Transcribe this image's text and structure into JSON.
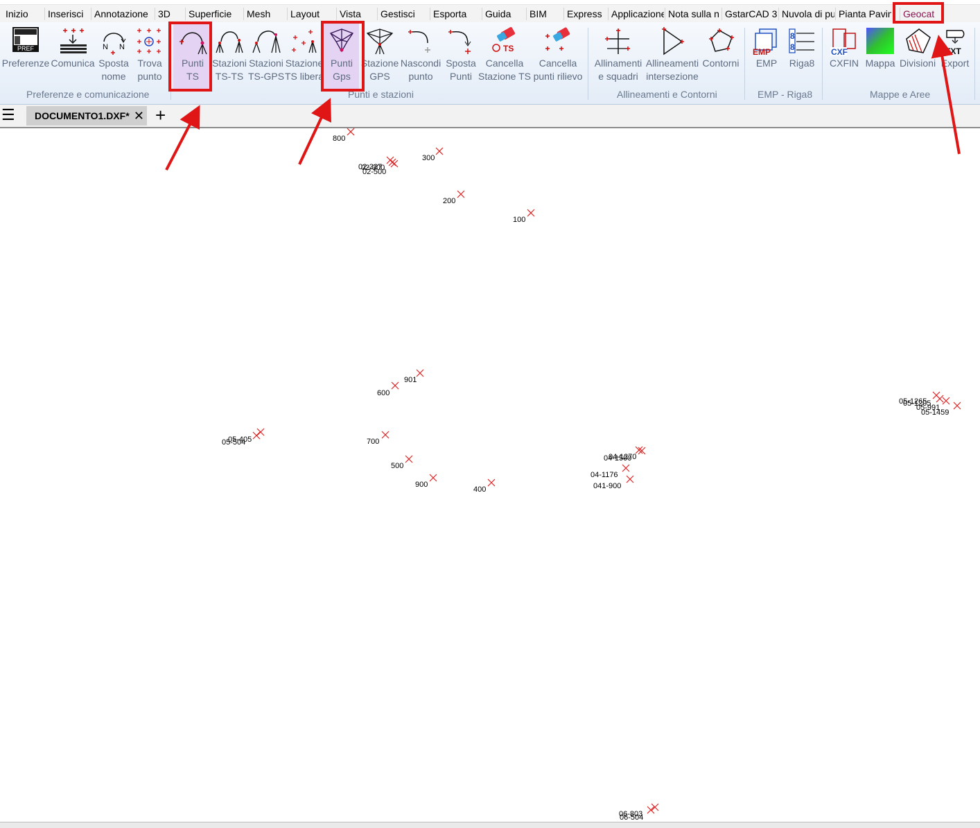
{
  "menu": {
    "items": [
      "Inizio",
      "Inserisci",
      "Annotazione",
      "3D",
      "Superficie",
      "Mesh",
      "Layout",
      "Vista",
      "Gestisci",
      "Esporta",
      "Guida",
      "BIM",
      "Express",
      "Applicazione",
      "Nota sulla n",
      "GstarCAD 3",
      "Nuvola di pu",
      "Pianta Pavin",
      "Geocat"
    ],
    "active": "Geocat"
  },
  "ribbon": {
    "buttons": [
      {
        "label": "Preferenze",
        "icon": "pref-icon"
      },
      {
        "label": "Comunica",
        "icon": "comunica-icon"
      },
      {
        "label": "Sposta\nnome",
        "icon": "sposta-nome-icon"
      },
      {
        "label": "Trova\npunto",
        "icon": "trova-punto-icon"
      },
      {
        "label": "Punti\nTS",
        "icon": "punti-ts-icon"
      },
      {
        "label": "Stazioni\nTS-TS",
        "icon": "stazioni-ts-ts-icon"
      },
      {
        "label": "Stazioni\nTS-GPS",
        "icon": "stazioni-ts-gps-icon"
      },
      {
        "label": "Stazione\nTS libera",
        "icon": "stazione-ts-libera-icon"
      },
      {
        "label": "Punti\nGps",
        "icon": "punti-gps-icon"
      },
      {
        "label": "Stazione\nGPS",
        "icon": "stazione-gps-icon"
      },
      {
        "label": "Nascondi\npunto",
        "icon": "nascondi-punto-icon"
      },
      {
        "label": "Sposta\nPunti",
        "icon": "sposta-punti-icon"
      },
      {
        "label": "Cancella\nStazione TS",
        "icon": "cancella-stazione-ts-icon"
      },
      {
        "label": "Cancella\npunti rilievo",
        "icon": "cancella-punti-rilievo-icon"
      },
      {
        "label": "Allinamenti\ne squadri",
        "icon": "allineamenti-squadri-icon"
      },
      {
        "label": "Allineamenti\nintersezione",
        "icon": "allineamenti-intersezione-icon"
      },
      {
        "label": "Contorni",
        "icon": "contorni-icon"
      },
      {
        "label": "EMP",
        "icon": "emp-icon"
      },
      {
        "label": "Riga8",
        "icon": "riga8-icon"
      },
      {
        "label": "CXFIN",
        "icon": "cxfin-icon"
      },
      {
        "label": "Mappa",
        "icon": "mappa-icon"
      },
      {
        "label": "Divisioni",
        "icon": "divisioni-icon"
      },
      {
        "label": "Export",
        "icon": "export-icon"
      }
    ],
    "groups": [
      "Preferenze e comunicazione",
      "Punti e stazioni",
      "Allineamenti e Contorni",
      "EMP - Riga8",
      "Mappe e Aree"
    ],
    "icon_text": {
      "pref": "PREF",
      "emp": "EMP",
      "cxf": "CXF",
      "txt": "TXT",
      "ts": "TS",
      "riga8": "8"
    }
  },
  "tabs": {
    "document": "DOCUMENTO1.DXF*",
    "close": "✕",
    "add": "+",
    "menu": "☰"
  },
  "points": [
    {
      "label": "800"
    },
    {
      "label": "300"
    },
    {
      "label": "02-327"
    },
    {
      "label": "02-300"
    },
    {
      "label": "02-500"
    },
    {
      "label": "200"
    },
    {
      "label": "100"
    },
    {
      "label": "901"
    },
    {
      "label": "600"
    },
    {
      "label": "700"
    },
    {
      "label": "500"
    },
    {
      "label": "900"
    },
    {
      "label": "400"
    },
    {
      "label": "05-405"
    },
    {
      "label": "05-504"
    },
    {
      "label": "04-1270"
    },
    {
      "label": "04-1500"
    },
    {
      "label": "04-1176"
    },
    {
      "label": "041-900"
    },
    {
      "label": "05-1265"
    },
    {
      "label": "05-1205"
    },
    {
      "label": "05-991"
    },
    {
      "label": "05-1459"
    },
    {
      "label": "06-803"
    },
    {
      "label": "06-504"
    }
  ],
  "colors": {
    "highlight": "#e01515",
    "marker": "#e02020",
    "ribbon_label": "#5d6b80",
    "selected_button": "#e4d3f2"
  }
}
